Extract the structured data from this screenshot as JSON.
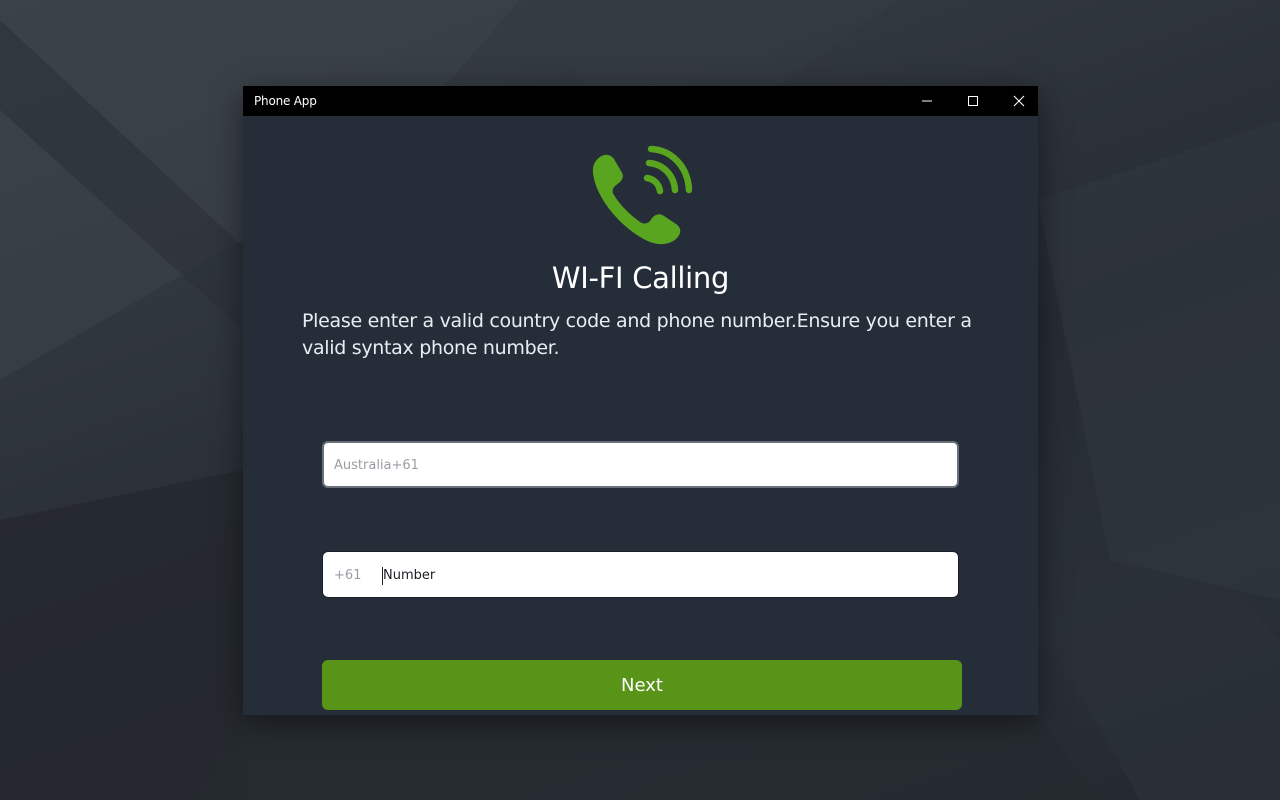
{
  "window": {
    "title": "Phone App"
  },
  "titlebar_buttons": {
    "minimize_icon": "minimize-icon",
    "maximize_icon": "maximize-icon",
    "close_icon": "close-icon"
  },
  "app": {
    "icon": "phone-wifi-icon",
    "heading": "WI-FI Calling",
    "instructions": "Please enter a valid country code and phone number.Ensure you enter a valid syntax phone number."
  },
  "form": {
    "country_placeholder": "Australia+61",
    "phone_prefix": "+61",
    "phone_placeholder": "Number",
    "phone_value": ""
  },
  "actions": {
    "next_label": "Next"
  },
  "colors": {
    "accent": "#589418",
    "icon_green": "#5aa51f",
    "window_bg": "#252d38",
    "titlebar_bg": "#000000"
  }
}
